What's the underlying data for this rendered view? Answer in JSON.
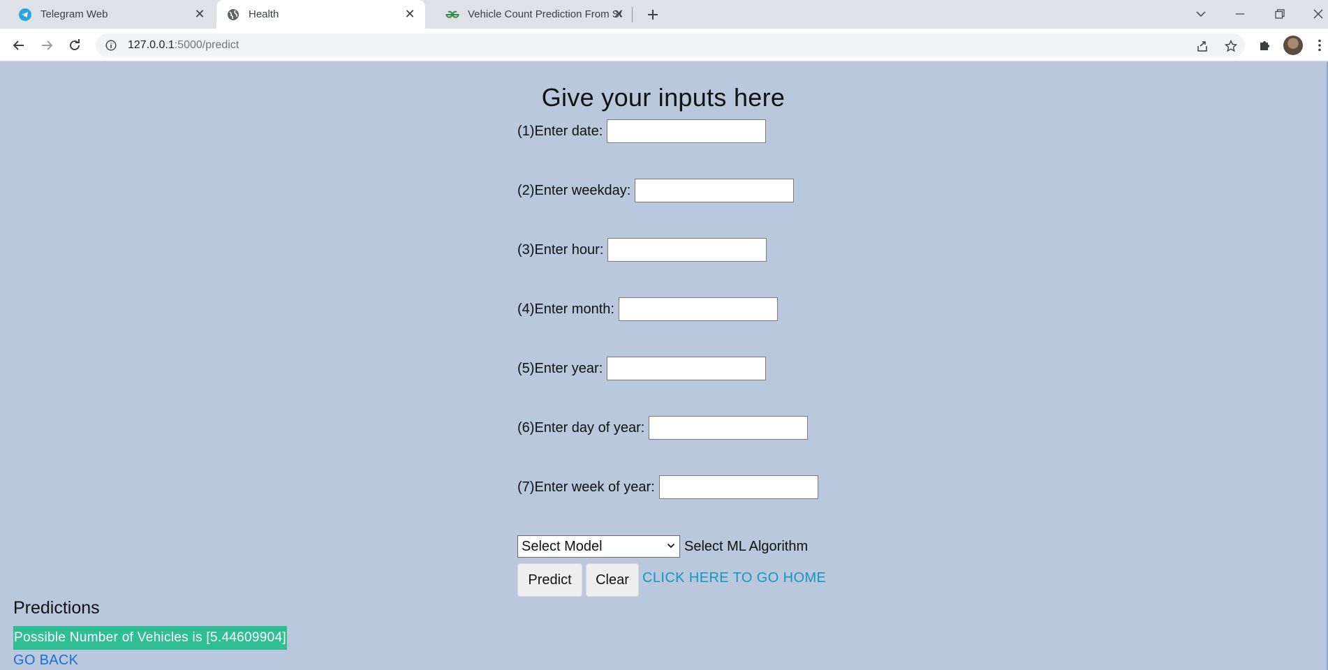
{
  "browser": {
    "tabs": [
      {
        "title": "Telegram Web",
        "icon": "telegram-icon"
      },
      {
        "title": "Health",
        "icon": "globe-icon"
      },
      {
        "title": "Vehicle Count Prediction From Sc",
        "icon": "geeksforgeeks-icon"
      }
    ],
    "url_host": "127.0.0.1",
    "url_path": ":5000/predict"
  },
  "page": {
    "heading": "Give your inputs here",
    "fields": [
      {
        "label": "(1)Enter date:",
        "value": ""
      },
      {
        "label": "(2)Enter weekday:",
        "value": ""
      },
      {
        "label": "(3)Enter hour:",
        "value": ""
      },
      {
        "label": "(4)Enter month:",
        "value": ""
      },
      {
        "label": "(5)Enter year:",
        "value": ""
      },
      {
        "label": "(6)Enter day of year:",
        "value": ""
      },
      {
        "label": "(7)Enter week of year:",
        "value": ""
      }
    ],
    "model_select": {
      "selected": "Select Model",
      "label": "Select ML Algorithm"
    },
    "predict_label": "Predict",
    "clear_label": "Clear",
    "home_link": "CLICK HERE TO GO HOME",
    "predictions_title": "Predictions",
    "prediction_text": "Possible Number of Vehicles is [5.44609904]",
    "go_back": "GO BACK"
  },
  "colors": {
    "page_bg": "#b9c8dc",
    "result_bg": "#2fbf92",
    "home_link": "#1796bd",
    "go_back": "#1a6fcf"
  }
}
